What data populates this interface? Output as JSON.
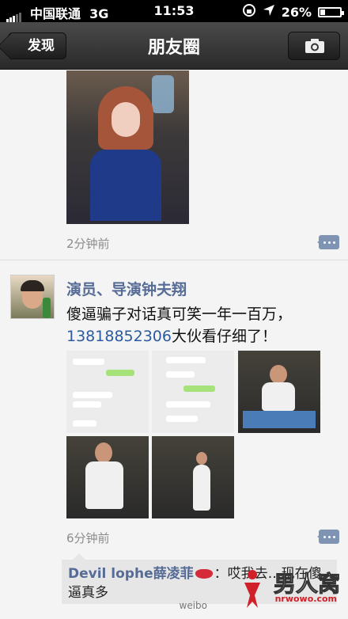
{
  "status_bar": {
    "carrier": "中国联通",
    "network": "3G",
    "time": "11:53",
    "battery": "26%",
    "battery_level": 0.26
  },
  "nav": {
    "back_label": "发现",
    "title": "朋友圈"
  },
  "posts": [
    {
      "time": "2分钟前"
    },
    {
      "author": "演员、导演钟夫翔",
      "text_line1": "傻逼骗子对话真可笑一年一百万，",
      "phone": "13818852306",
      "text_line2_rest": "大伙看仔细了！",
      "time": "6分钟前",
      "reply": {
        "name": "Devil lophe薛凌菲",
        "text": "：哎我去…现在傻逼真多"
      }
    }
  ],
  "watermark": {
    "weibo": "weibo",
    "brand": "男人窝",
    "url": "nrwowo.com"
  },
  "colors": {
    "accent": "#566b95",
    "link": "#2b5b9e",
    "background": "#f4f4f4"
  }
}
